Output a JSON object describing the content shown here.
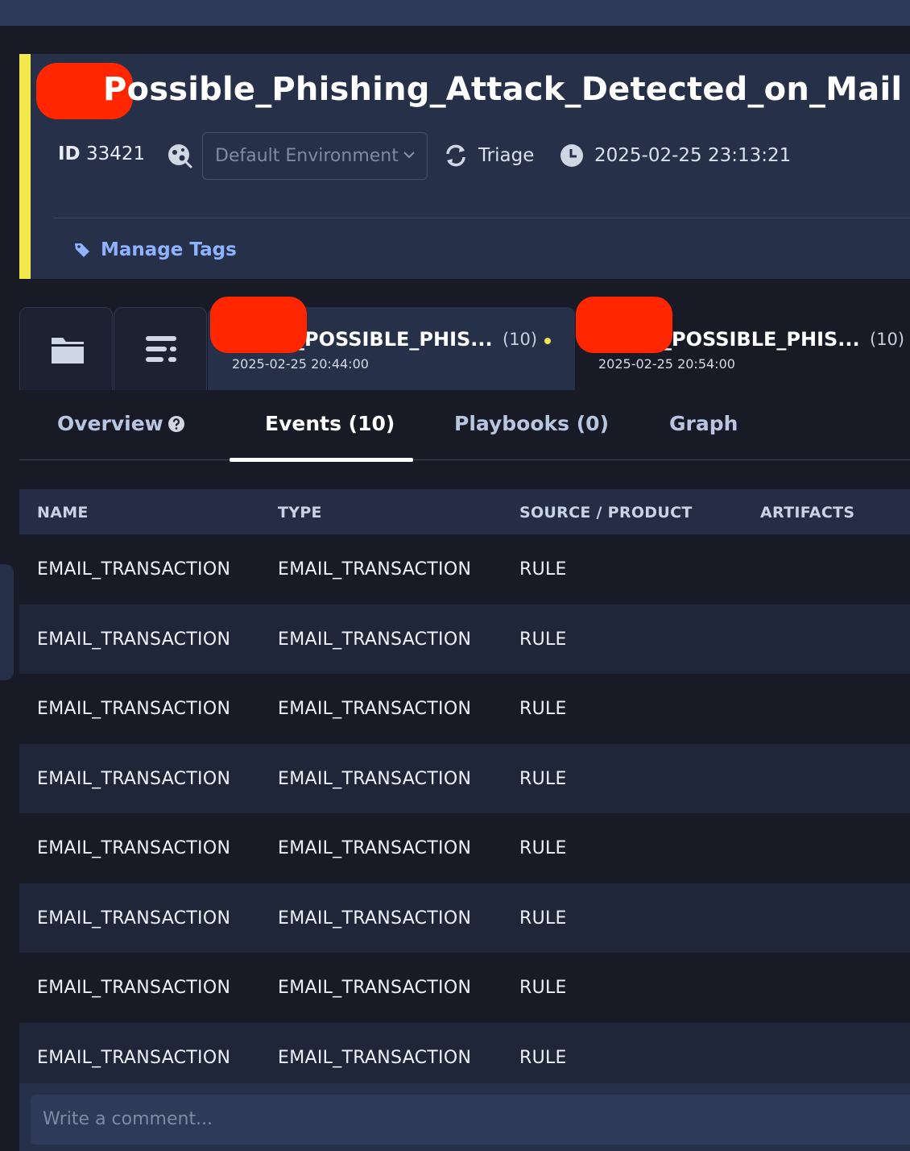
{
  "header": {
    "title": "Possible_Phishing_Attack_Detected_on_Mail",
    "id_label": "ID",
    "id_value": "33421",
    "environment": "Default Environment",
    "stage": "Triage",
    "datetime": "2025-02-25 23:13:21",
    "manage_tags": "Manage Tags",
    "accent_color": "#f2e94e"
  },
  "alert_tabs": [
    {
      "name": "_POSSIBLE_PHIS...",
      "count": "(10)",
      "date": "2025-02-25 20:44:00",
      "active": true
    },
    {
      "name": "_POSSIBLE_PHIS...",
      "count": "(10)",
      "date": "2025-02-25 20:54:00",
      "active": false
    }
  ],
  "subtabs": {
    "overview": "Overview",
    "events": "Events (10)",
    "playbooks": "Playbooks (0)",
    "graph": "Graph"
  },
  "table": {
    "headers": [
      "NAME",
      "TYPE",
      "SOURCE / PRODUCT",
      "ARTIFACTS"
    ],
    "rows": [
      [
        "EMAIL_TRANSACTION",
        "EMAIL_TRANSACTION",
        "RULE",
        ""
      ],
      [
        "EMAIL_TRANSACTION",
        "EMAIL_TRANSACTION",
        "RULE",
        ""
      ],
      [
        "EMAIL_TRANSACTION",
        "EMAIL_TRANSACTION",
        "RULE",
        ""
      ],
      [
        "EMAIL_TRANSACTION",
        "EMAIL_TRANSACTION",
        "RULE",
        ""
      ],
      [
        "EMAIL_TRANSACTION",
        "EMAIL_TRANSACTION",
        "RULE",
        ""
      ],
      [
        "EMAIL_TRANSACTION",
        "EMAIL_TRANSACTION",
        "RULE",
        ""
      ],
      [
        "EMAIL_TRANSACTION",
        "EMAIL_TRANSACTION",
        "RULE",
        ""
      ],
      [
        "EMAIL_TRANSACTION",
        "EMAIL_TRANSACTION",
        "RULE",
        ""
      ]
    ]
  },
  "comment": {
    "placeholder": "Write a comment..."
  },
  "icons": {
    "environment": "environment-globe-icon",
    "stage": "refresh-cycle-icon",
    "time": "clock-icon",
    "tag": "tag-icon",
    "folder": "folder-icon",
    "list": "list-icon",
    "help": "question-circle-icon"
  }
}
